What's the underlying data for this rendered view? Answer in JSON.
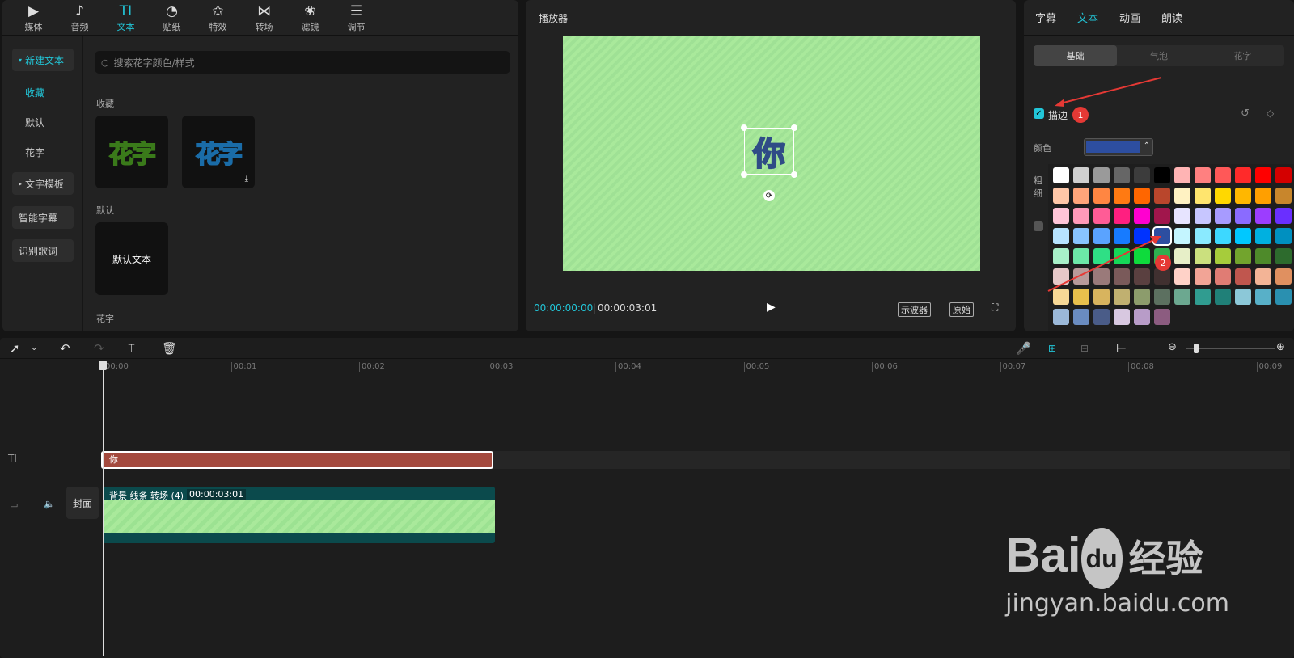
{
  "toolbar": {
    "tabs": [
      {
        "label": "媒体",
        "icon": "media-icon",
        "glyph": "▶"
      },
      {
        "label": "音频",
        "icon": "audio-icon",
        "glyph": "♪"
      },
      {
        "label": "文本",
        "icon": "text-icon",
        "glyph": "TI"
      },
      {
        "label": "贴纸",
        "icon": "sticker-icon",
        "glyph": "◔"
      },
      {
        "label": "特效",
        "icon": "effect-icon",
        "glyph": "✩"
      },
      {
        "label": "转场",
        "icon": "transition-icon",
        "glyph": "⋈"
      },
      {
        "label": "滤镜",
        "icon": "filter-icon",
        "glyph": "❀"
      },
      {
        "label": "调节",
        "icon": "adjust-icon",
        "glyph": "☰"
      }
    ]
  },
  "sidebar": {
    "new_text": "新建文本",
    "favorites": "收藏",
    "default": "默认",
    "fancy": "花字",
    "text_template": "文字模板",
    "smart_caption": "智能字幕",
    "lyrics": "识别歌词"
  },
  "library": {
    "search_placeholder": "搜索花字颜色/样式",
    "sec_favorites": "收藏",
    "card1": "花字",
    "card2": "花字",
    "sec_default": "默认",
    "default_text": "默认文本",
    "sec_fancy": "花字"
  },
  "player": {
    "title": "播放器",
    "canvas_text": "你",
    "time_current": "00:00:00:00",
    "time_total": "00:00:03:01",
    "scope": "示波器",
    "original": "原始"
  },
  "inspector": {
    "tabs": [
      "字幕",
      "文本",
      "动画",
      "朗读"
    ],
    "segments": [
      "基础",
      "气泡",
      "花字"
    ],
    "stroke_label": "描边",
    "color_label": "颜色",
    "thickness_label": "粗细",
    "badge1": "1",
    "badge2": "2",
    "colors": [
      "#ffffff",
      "#cfcfcf",
      "#9a9a9a",
      "#666666",
      "#3c3c3c",
      "#000000",
      "#ffb4b4",
      "#ff8080",
      "#ff5858",
      "#ff2a2a",
      "#ff0000",
      "#d40000",
      "#ffc7a8",
      "#ffa57a",
      "#ff8642",
      "#ff7a12",
      "#ff6600",
      "#b9462c",
      "#fff2c2",
      "#ffe56e",
      "#ffd800",
      "#ffb700",
      "#ff9f00",
      "#c8862c",
      "#ffc5d8",
      "#ff9ab9",
      "#ff5c96",
      "#ff1f80",
      "#ff00d0",
      "#a1164c",
      "#e7e4ff",
      "#c7c6ff",
      "#a79bff",
      "#8a6bff",
      "#9c3dff",
      "#6a2fff",
      "#b7e3ff",
      "#88c4ff",
      "#5aa3ff",
      "#177bff",
      "#0033ff",
      "#2d4ea0",
      "#c4f5ff",
      "#8aeaff",
      "#3dd8ff",
      "#00c8ff",
      "#00b0e0",
      "#0090c0",
      "#a8f0c8",
      "#6ce8a8",
      "#2fdf85",
      "#15d858",
      "#0edb3c",
      "#2fb050",
      "#e7efc8",
      "#cbe07e",
      "#a6cc3b",
      "#72a42d",
      "#4e8a2a",
      "#2d6b2d",
      "#e6c8c8",
      "#b89a9a",
      "#9a7a7a",
      "#7a5a5a",
      "#5a4040",
      "#403030",
      "#ffd2c8",
      "#f2a496",
      "#e07c74",
      "#c0564e",
      "#f3b496",
      "#e09060",
      "#f6d896",
      "#e8c04c",
      "#d8b45e",
      "#c0b070",
      "#8c9c6c",
      "#5c7060",
      "#6ca890",
      "#309c90",
      "#208078",
      "#8cc8d8",
      "#58b0c8",
      "#2a90b0",
      "#9bb8d8",
      "#6a8cc0",
      "#4a5c88",
      "#d8c8e0",
      "#b89cc8",
      "#8c5c80"
    ],
    "selected_color": "#2d4ea0"
  },
  "timeline": {
    "ticks": [
      "00:00",
      "00:01",
      "00:02",
      "00:03",
      "00:04",
      "00:05",
      "00:06",
      "00:07",
      "00:08",
      "00:09"
    ],
    "text_clip": "你",
    "video_clip_label": "背景 线条 转场 (4)",
    "video_clip_duration": "00:00:03:01",
    "cover": "封面"
  },
  "watermark": {
    "brand": "Bai",
    "du": "du",
    "suffix": "经验",
    "url": "jingyan.baidu.com"
  }
}
